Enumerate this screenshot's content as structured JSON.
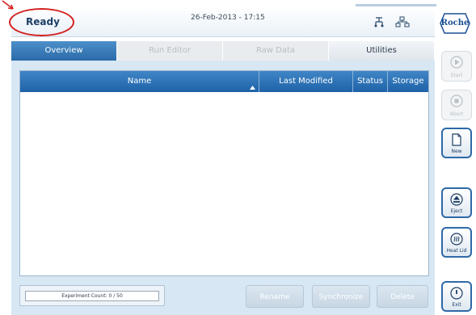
{
  "status": {
    "state": "Ready",
    "datetime": "26-Feb-2013 - 17:15"
  },
  "brand": {
    "logo_text": "Roche"
  },
  "tabs": [
    {
      "label": "Overview",
      "state": "active"
    },
    {
      "label": "Run Editor",
      "state": "disabled"
    },
    {
      "label": "Raw Data",
      "state": "disabled"
    },
    {
      "label": "Utilities",
      "state": "enabled"
    }
  ],
  "table": {
    "columns": [
      "Name",
      "Last Modified",
      "Status",
      "Storage"
    ],
    "rows": []
  },
  "footer": {
    "experiment_count": "Experiment Count: 0 / 50",
    "rename": "Rename",
    "synchronize": "Synchronize",
    "delete": "Delete"
  },
  "side_buttons": {
    "start": "Start",
    "abort": "Abort",
    "new": "New",
    "eject": "Eject",
    "heat_lid": "Heat Lid",
    "exit": "Exit"
  },
  "colors": {
    "accent": "#2a6aa8",
    "annotation": "#d42020"
  },
  "icons": {
    "network": "network-icon",
    "connection": "connection-icon",
    "start": "play-icon",
    "abort": "stop-icon",
    "new": "document-icon",
    "eject": "eject-icon",
    "heat_lid": "heat-icon",
    "exit": "power-icon"
  }
}
